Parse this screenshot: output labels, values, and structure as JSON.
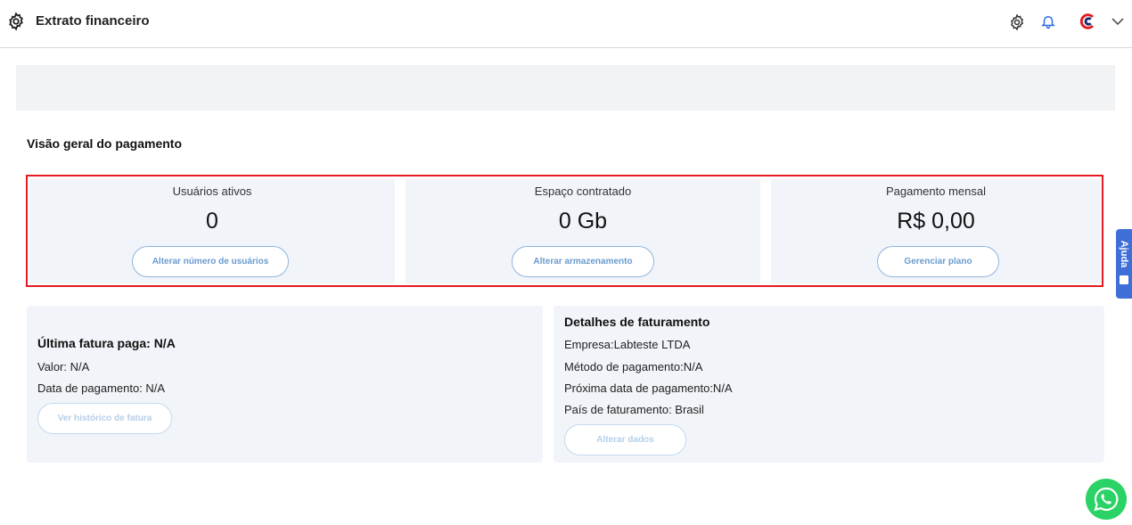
{
  "header": {
    "title": "Extrato financeiro"
  },
  "overview": {
    "section_title": "Visão geral do pagamento",
    "cards": [
      {
        "label": "Usuários ativos",
        "value": "0",
        "button": "Alterar número de usuários"
      },
      {
        "label": "Espaço contratado",
        "value": "0 Gb",
        "button": "Alterar armazenamento"
      },
      {
        "label": "Pagamento mensal",
        "value": "R$ 0,00",
        "button": "Gerenciar plano"
      }
    ]
  },
  "last_invoice": {
    "title": "Última fatura paga: N/A",
    "value_line": "Valor: N/A",
    "date_line": "Data de pagamento: N/A",
    "button": "Ver histórico de fatura"
  },
  "billing": {
    "title": "Detalhes de faturamento",
    "company": "Empresa:Labteste LTDA",
    "method": "Método de pagamento:N/A",
    "next_date": "Próxima data de pagamento:N/A",
    "country": "País de faturamento: Brasil",
    "button": "Alterar dados"
  },
  "help": {
    "label": "Ajuda"
  },
  "colors": {
    "highlight": "#e31b23",
    "accent": "#3f6fd6",
    "whatsapp": "#2bd366"
  }
}
